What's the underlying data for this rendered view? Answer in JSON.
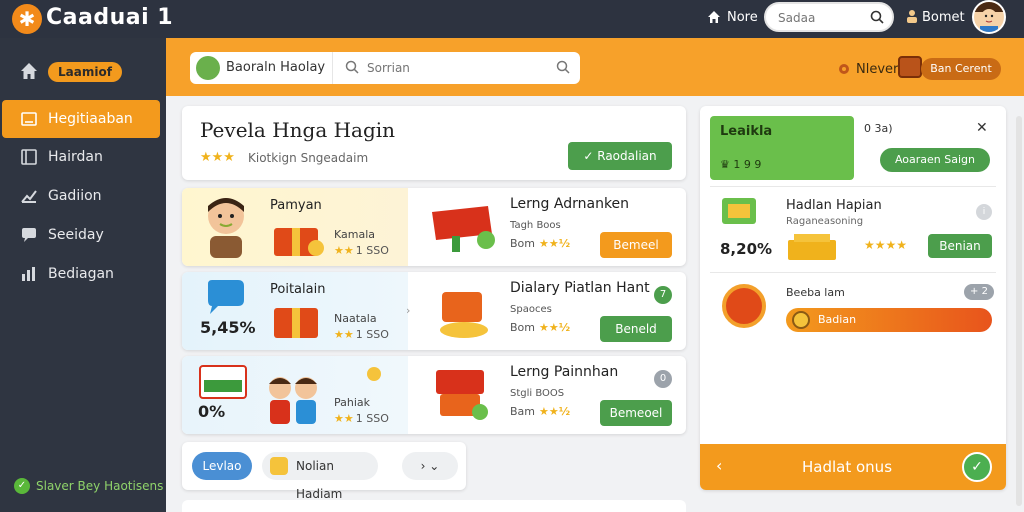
{
  "app": {
    "brand": "Caaduai 1",
    "logo_glyph": "✱"
  },
  "topbar": {
    "home_label": "Nore",
    "search_placeholder": "Sadaa",
    "user_label": "Bomet"
  },
  "sidebar": {
    "pill": "Laamiof",
    "items": [
      {
        "label": "Hegitiaaban",
        "icon": "edit-icon",
        "active": true
      },
      {
        "label": "Hairdan",
        "icon": "book-icon"
      },
      {
        "label": "Gadiion",
        "icon": "chart-icon"
      },
      {
        "label": "Seeiday",
        "icon": "chat-icon"
      },
      {
        "label": "Bediagan",
        "icon": "bars-icon"
      }
    ],
    "footer": "Slaver Bey Haotisens"
  },
  "band": {
    "left_label": "Baoraln Haolay",
    "search_placeholder": "Sorrian",
    "never_label": "Nlever",
    "button": "Ban Cerent"
  },
  "hero": {
    "title": "Pevela Hnga Hagin",
    "stars": "★★★",
    "subtitle": "Kiotkign Sngeadaim",
    "button": "Raodalian"
  },
  "cards": [
    {
      "left_title": "Pamyan",
      "left_sub": "Kamala",
      "left_stars": "★★",
      "left_code": "1 SSO",
      "right_title": "Lerng Adrnanken",
      "right_sub": "Tagh Boos",
      "right_pre": "Bom",
      "right_stars": "★★½",
      "button": "Bemeel",
      "btn_color": "orange"
    },
    {
      "left_title": "Poitalain",
      "left_sub": "Naatala",
      "left_stars": "★★",
      "left_code": "1 SSO",
      "left_pct": "5,45%",
      "right_title": "Dialary Piatlan Hant",
      "right_sub": "Spaoces",
      "right_pre": "Bom",
      "right_stars": "★★½",
      "button": "Beneld",
      "badge": "7",
      "btn_color": "green"
    },
    {
      "left_title": "",
      "left_sub": "Pahiak",
      "left_stars": "★★",
      "left_code": "1 SSO",
      "left_pct": "0%",
      "right_title": "Lerng Painnhan",
      "right_sub": "Stgli BOOS",
      "right_pre": "Bam",
      "right_stars": "★★½",
      "button": "Bemeoel",
      "badge": "0",
      "btn_color": "green"
    }
  ],
  "pager": {
    "first": "Levlao",
    "mid": "Nolian Hadiam",
    "last": "›"
  },
  "right_panel": {
    "head_title": "Leaikla",
    "head_nums": "1 9 9",
    "meta": "0 3a)",
    "cta": "Aoaraen Saign",
    "item1_title": "Hadlan Hapian",
    "item1_sub": "Raganeasoning",
    "item1_pct": "8,20%",
    "item1_stars": "★★★★",
    "item1_button": "Benian",
    "item2_title": "Beeba lam",
    "item2_toggle": "+ 2",
    "item2_bar": "Badian",
    "footer_label": "Hadlat onus"
  },
  "colors": {
    "accent": "#f39a1d",
    "sidebar": "#2f3541",
    "green": "#4c9e4c",
    "topbar": "#2d3340"
  }
}
